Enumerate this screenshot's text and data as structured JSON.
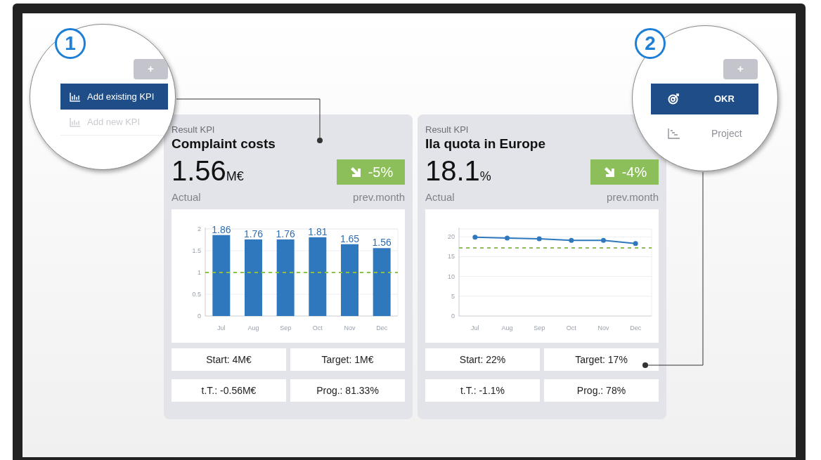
{
  "cards": [
    {
      "kicker": "Result KPI",
      "title": "Complaint costs",
      "value": "1.56",
      "unit": "M€",
      "change": "-5%",
      "actual_label": "Actual",
      "compare_label": "prev.month",
      "chart_data": {
        "type": "bar",
        "categories": [
          "Jul",
          "Aug",
          "Sep",
          "Oct",
          "Nov",
          "Dec"
        ],
        "series": [
          {
            "color": "#2f78bd",
            "values": [
              1.86,
              1.76,
              1.76,
              1.81,
              1.65,
              1.56
            ]
          }
        ],
        "ylim": [
          0,
          2
        ],
        "yticks": [
          0,
          0.5,
          1,
          1.5,
          2
        ],
        "data_labels": true,
        "grid": true,
        "ref_lines": [
          {
            "axis": "y",
            "value": 1,
            "color": "#8cbf4f"
          }
        ]
      },
      "stats": [
        "Start: 4M€",
        "Target: 1M€",
        "t.T.: -0.56M€",
        "Prog.: 81.33%"
      ]
    },
    {
      "kicker": "Result KPI",
      "title": "Ila quota in Europe",
      "value": "18.1",
      "unit": "%",
      "change": "-4%",
      "actual_label": "Actual",
      "compare_label": "prev.month",
      "chart_data": {
        "type": "line",
        "categories": [
          "Jul",
          "Aug",
          "Sep",
          "Oct",
          "Nov",
          "Dec"
        ],
        "series": [
          {
            "color": "#2f78bd",
            "marker": "o",
            "values": [
              19.9,
              19.7,
              19.5,
              19.1,
              19.1,
              18.3
            ]
          }
        ],
        "ylim": [
          0,
          22
        ],
        "yticks": [
          0,
          5,
          10,
          15,
          20
        ],
        "grid": true,
        "ref_lines": [
          {
            "axis": "y",
            "value": 17.2,
            "color": "#8cbf4f"
          }
        ]
      },
      "stats": [
        "Start: 22%",
        "Target: 17%",
        "t.T.: -1.1%",
        "Prog.: 78%"
      ]
    }
  ],
  "callouts": [
    {
      "number": "1",
      "plus": "+",
      "items": [
        {
          "label": "Add existing KPI",
          "kind": "bars",
          "selected": true,
          "disabled": false
        },
        {
          "label": "Add new KPI",
          "kind": "bars",
          "selected": false,
          "disabled": true
        }
      ]
    },
    {
      "number": "2",
      "plus": "+",
      "items": [
        {
          "label": "OKR",
          "kind": "target",
          "selected": true,
          "disabled": false
        },
        {
          "label": "Project",
          "kind": "gantt",
          "selected": false,
          "disabled": false
        }
      ]
    }
  ]
}
